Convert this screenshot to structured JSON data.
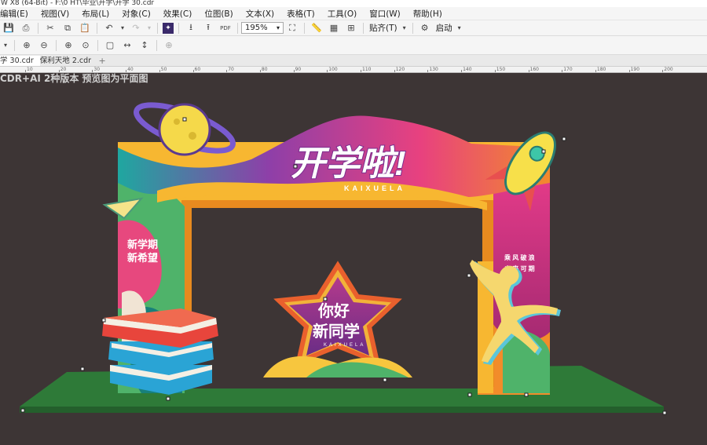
{
  "window": {
    "title": "W X8 (64-Bit) - F:\\0 HT\\毕业\\开学\\开学 30.cdr"
  },
  "menu": [
    "编辑(E)",
    "视图(V)",
    "布局(L)",
    "对象(C)",
    "效果(C)",
    "位图(B)",
    "文本(X)",
    "表格(T)",
    "工具(O)",
    "窗口(W)",
    "帮助(H)"
  ],
  "toolbar": {
    "zoom": "195%",
    "snap_label": "贴齐(T)",
    "launch_label": "启动"
  },
  "tabs": [
    "学 30.cdr",
    "保利天地 2.cdr"
  ],
  "ruler": {
    "ticks": [
      "10",
      "20",
      "30",
      "40",
      "50",
      "60",
      "70",
      "80",
      "90",
      "100",
      "110",
      "120",
      "130",
      "140",
      "150",
      "160",
      "170",
      "180",
      "190",
      "200"
    ]
  },
  "canvas": {
    "caption": "CDR+AI 2种版本 预览图为平面图"
  },
  "design": {
    "main_title": "开学啦!",
    "main_subtitle": "KAIXUELA",
    "left_line1": "新学期",
    "left_line2": "新希望",
    "right_line1": "乘 风 破 浪",
    "right_line2": "未 来 可 期",
    "center_line1": "你好",
    "center_line2": "新同学",
    "center_subtitle": "KAIXUELA"
  },
  "colors": {
    "canvas_bg": "#3d3535",
    "ground": "#2e6b35",
    "arch_yellow": "#f7b731",
    "arch_pink": "#e6307f",
    "arch_orange": "#ef7d22",
    "book_red": "#e8453c",
    "book_blue": "#2aa4d5"
  }
}
